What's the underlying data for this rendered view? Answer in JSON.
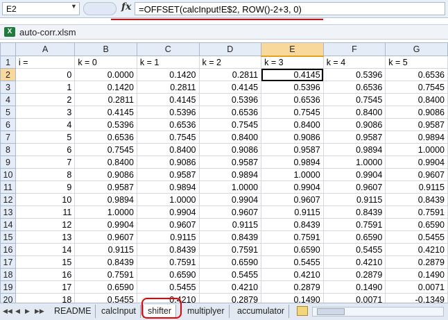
{
  "formula_bar": {
    "name_box": "E2",
    "fx_label": "fx",
    "formula": "=OFFSET(calcInput!E$2, ROW()-2+3, 0)"
  },
  "workbook": {
    "title": "auto-corr.xlsm",
    "icon": "excel-icon"
  },
  "grid": {
    "columns": [
      "A",
      "B",
      "C",
      "D",
      "E",
      "F",
      "G"
    ],
    "selected_column": "E",
    "selected_row": 2,
    "header_row": [
      "i =",
      "k = 0",
      "k = 1",
      "k = 2",
      "k = 3",
      "k = 4",
      "k = 5"
    ],
    "rows": [
      [
        "0",
        "0.0000",
        "0.1420",
        "0.2811",
        "0.4145",
        "0.5396",
        "0.6536"
      ],
      [
        "1",
        "0.1420",
        "0.2811",
        "0.4145",
        "0.5396",
        "0.6536",
        "0.7545"
      ],
      [
        "2",
        "0.2811",
        "0.4145",
        "0.5396",
        "0.6536",
        "0.7545",
        "0.8400"
      ],
      [
        "3",
        "0.4145",
        "0.5396",
        "0.6536",
        "0.7545",
        "0.8400",
        "0.9086"
      ],
      [
        "4",
        "0.5396",
        "0.6536",
        "0.7545",
        "0.8400",
        "0.9086",
        "0.9587"
      ],
      [
        "5",
        "0.6536",
        "0.7545",
        "0.8400",
        "0.9086",
        "0.9587",
        "0.9894"
      ],
      [
        "6",
        "0.7545",
        "0.8400",
        "0.9086",
        "0.9587",
        "0.9894",
        "1.0000"
      ],
      [
        "7",
        "0.8400",
        "0.9086",
        "0.9587",
        "0.9894",
        "1.0000",
        "0.9904"
      ],
      [
        "8",
        "0.9086",
        "0.9587",
        "0.9894",
        "1.0000",
        "0.9904",
        "0.9607"
      ],
      [
        "9",
        "0.9587",
        "0.9894",
        "1.0000",
        "0.9904",
        "0.9607",
        "0.9115"
      ],
      [
        "10",
        "0.9894",
        "1.0000",
        "0.9904",
        "0.9607",
        "0.9115",
        "0.8439"
      ],
      [
        "11",
        "1.0000",
        "0.9904",
        "0.9607",
        "0.9115",
        "0.8439",
        "0.7591"
      ],
      [
        "12",
        "0.9904",
        "0.9607",
        "0.9115",
        "0.8439",
        "0.7591",
        "0.6590"
      ],
      [
        "13",
        "0.9607",
        "0.9115",
        "0.8439",
        "0.7591",
        "0.6590",
        "0.5455"
      ],
      [
        "14",
        "0.9115",
        "0.8439",
        "0.7591",
        "0.6590",
        "0.5455",
        "0.4210"
      ],
      [
        "15",
        "0.8439",
        "0.7591",
        "0.6590",
        "0.5455",
        "0.4210",
        "0.2879"
      ],
      [
        "16",
        "0.7591",
        "0.6590",
        "0.5455",
        "0.4210",
        "0.2879",
        "0.1490"
      ],
      [
        "17",
        "0.6590",
        "0.5455",
        "0.4210",
        "0.2879",
        "0.1490",
        "0.0071"
      ],
      [
        "18",
        "0.5455",
        "0.4210",
        "0.2879",
        "0.1490",
        "0.0071",
        "-0.1349"
      ]
    ]
  },
  "sheet_tabs": {
    "items": [
      "README",
      "calcInput",
      "shifter",
      "multiplyer",
      "accumulator"
    ],
    "active": "shifter",
    "nav": [
      "◀◀",
      "◀",
      "▶",
      "▶▶"
    ]
  }
}
